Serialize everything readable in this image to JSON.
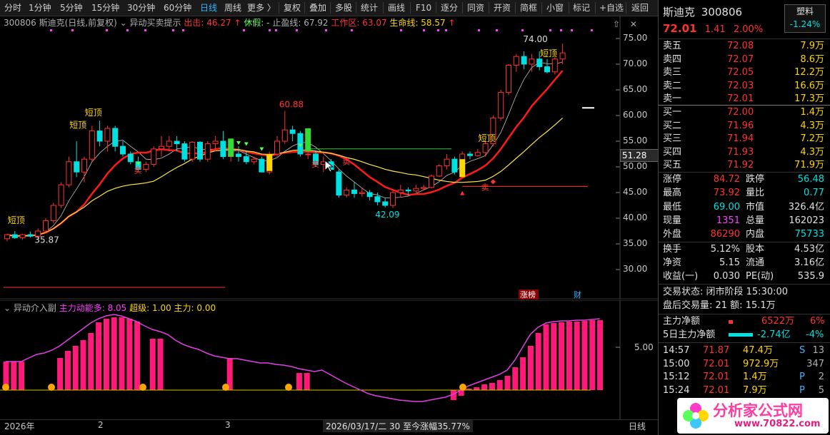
{
  "toolbar": {
    "periods": [
      "分时",
      "1分钟",
      "5分钟",
      "15分钟",
      "30分钟",
      "60分钟",
      "日线",
      "周线",
      "更多 〉"
    ],
    "active_period": "日线",
    "tools": [
      "复权",
      "叠加",
      "多股",
      "统计",
      "画线",
      "F10",
      "逐分",
      "同资",
      "开资",
      "简框",
      "小窗",
      "标记",
      "+自选",
      "返回"
    ]
  },
  "main_header": {
    "stock": "300806 斯迪克(日线,前复权)",
    "indicator": "异动买卖提示",
    "out_label": "出击: 46.27",
    "rest_label": "休假: -",
    "stop_label": "止盈线: 67.92",
    "work_label": "工作区: 63.07",
    "life_label": "生命线: 58.57"
  },
  "price_axis": [
    "75.00",
    "70.00",
    "65.00",
    "60.00",
    "55.00",
    "50.00",
    "45.00",
    "40.00",
    "35.00",
    "30.00"
  ],
  "current_price_tag": "51.28",
  "annotations": {
    "high_label": "60.88",
    "low_label": "42.09",
    "start_low": "35.87",
    "last_high": "74.00",
    "short_top": "短顶",
    "buy_mark": "买",
    "sell_mark": "卖",
    "zhangbang": "涨榜",
    "cai": "财"
  },
  "ind_header": {
    "name": "异动介入副",
    "main_force": "主力动能多: 8.05",
    "super": "超级: 1.00",
    "force": "主力: 0.00"
  },
  "ind_axis": "5.00",
  "date_bar": {
    "year": "2026年",
    "m2": "2",
    "m3": "3",
    "status": "2026/03/17/二  30  至今涨幅35.77%",
    "period": "日线"
  },
  "right_panel": {
    "name": "斯迪克",
    "code": "300806",
    "tag": "塑料",
    "tag_pct": "-1.24%",
    "price": "72.01",
    "change": "1.41",
    "change_pct": "2.00%",
    "asks": [
      {
        "label": "卖五",
        "price": "72.08",
        "vol": "7.9万"
      },
      {
        "label": "卖四",
        "price": "72.07",
        "vol": "8.6万"
      },
      {
        "label": "卖三",
        "price": "72.05",
        "vol": "12.2万"
      },
      {
        "label": "卖二",
        "price": "72.03",
        "vol": "16.6万"
      },
      {
        "label": "卖一",
        "price": "72.01",
        "vol": "17.3万"
      }
    ],
    "bids": [
      {
        "label": "买一",
        "price": "72.00",
        "vol": "1.4万"
      },
      {
        "label": "买二",
        "price": "71.96",
        "vol": "4.3万"
      },
      {
        "label": "买三",
        "price": "71.94",
        "vol": "7.2万"
      },
      {
        "label": "买四",
        "price": "71.93",
        "vol": "4.3万"
      },
      {
        "label": "买五",
        "price": "71.92",
        "vol": "71.9万"
      }
    ],
    "stats": [
      {
        "l1": "涨停",
        "v1": "84.72",
        "c1": "red",
        "l2": "跌停",
        "v2": "56.48",
        "c2": "grn"
      },
      {
        "l1": "最高",
        "v1": "73.92",
        "c1": "red",
        "l2": "量比",
        "v2": "0.77",
        "c2": "grn"
      },
      {
        "l1": "最低",
        "v1": "69.00",
        "c1": "grn",
        "l2": "市值",
        "v2": "326.4亿",
        "c2": "wht"
      },
      {
        "l1": "现量",
        "v1": "1351",
        "c1": "mag",
        "l2": "总量",
        "v2": "162023",
        "c2": "wht"
      },
      {
        "l1": "外盘",
        "v1": "86290",
        "c1": "red",
        "l2": "内盘",
        "v2": "75733",
        "c2": "grn"
      }
    ],
    "stats2": [
      {
        "l1": "换手",
        "v1": "5.12%",
        "l2": "股本",
        "v2": "4.53亿"
      },
      {
        "l1": "净资",
        "v1": "5.15",
        "l2": "流通",
        "v2": "3.16亿"
      },
      {
        "l1": "收益(一)",
        "v1": "0.030",
        "l2": "PE(动)",
        "v2": "535.9"
      }
    ],
    "trade_status": "交易状态: 闭市阶段 15:30:00",
    "after_hours": "盘后交易量: 21  额: 15.1万",
    "net_main_label": "主力净额",
    "net_main_val": "6522万",
    "net_main_pct": "6%",
    "net5_label": "5日主力净额",
    "net5_val": "-2.74亿",
    "net5_pct": "-4%",
    "ticks": [
      {
        "t": "14:57",
        "p": "71.87",
        "v": "47.4万",
        "f": "S",
        "n": "13"
      },
      {
        "t": "15:00",
        "p": "72.01",
        "v": "972.9万",
        "f": "",
        "n": "347"
      },
      {
        "t": "15:12",
        "p": "72.01",
        "v": "1.4万",
        "f": "P",
        "n": "2"
      },
      {
        "t": "15:24",
        "p": "72.01",
        "v": "7.9万",
        "f": "P",
        "n": "5"
      }
    ],
    "logo_text": "分析家公式网",
    "logo_url": "www.70822.com"
  },
  "colors": {
    "up": "#ff3232",
    "down": "#00e0e0",
    "ma_red": "#ff1a1a",
    "ma_yellow": "#ffe44d",
    "ma_white": "#c0c0c0",
    "bar_pink": "#ff1a7a",
    "line_magenta": "#e040e0"
  }
}
